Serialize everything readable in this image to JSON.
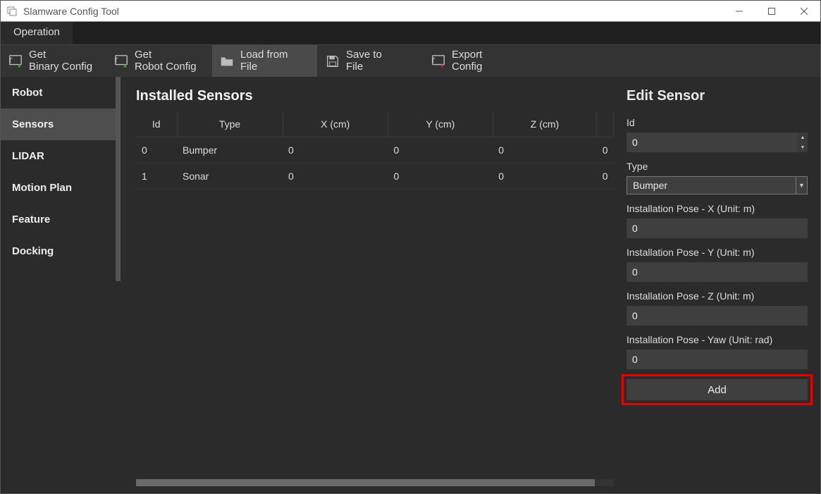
{
  "window": {
    "title": "Slamware Config Tool"
  },
  "tabs": {
    "operation": "Operation"
  },
  "toolbar": {
    "get_binary": {
      "line1": "Get",
      "line2": "Binary Config"
    },
    "get_robot": {
      "line1": "Get",
      "line2": "Robot Config"
    },
    "load_file": {
      "line1": "Load from",
      "line2": "File"
    },
    "save_file": {
      "line1": "Save to",
      "line2": "File"
    },
    "export": {
      "line1": "Export",
      "line2": "Config"
    }
  },
  "sidebar": {
    "items": [
      {
        "label": "Robot"
      },
      {
        "label": "Sensors"
      },
      {
        "label": "LIDAR"
      },
      {
        "label": "Motion Plan"
      },
      {
        "label": "Feature"
      },
      {
        "label": "Docking"
      }
    ],
    "active_index": 1
  },
  "installed": {
    "title": "Installed Sensors",
    "columns": {
      "id": "Id",
      "type": "Type",
      "x": "X (cm)",
      "y": "Y (cm)",
      "z": "Z (cm)"
    },
    "rows": [
      {
        "id": "0",
        "type": "Bumper",
        "x": "0",
        "y": "0",
        "z": "0",
        "extra": "0"
      },
      {
        "id": "1",
        "type": "Sonar",
        "x": "0",
        "y": "0",
        "z": "0",
        "extra": "0"
      }
    ]
  },
  "edit": {
    "title": "Edit Sensor",
    "labels": {
      "id": "Id",
      "type": "Type",
      "pose_x": "Installation Pose - X (Unit: m)",
      "pose_y": "Installation Pose - Y (Unit: m)",
      "pose_z": "Installation Pose - Z (Unit: m)",
      "pose_yaw": "Installation Pose - Yaw (Unit: rad)"
    },
    "values": {
      "id": "0",
      "type": "Bumper",
      "pose_x": "0",
      "pose_y": "0",
      "pose_z": "0",
      "pose_yaw": "0"
    },
    "add_button": "Add"
  }
}
